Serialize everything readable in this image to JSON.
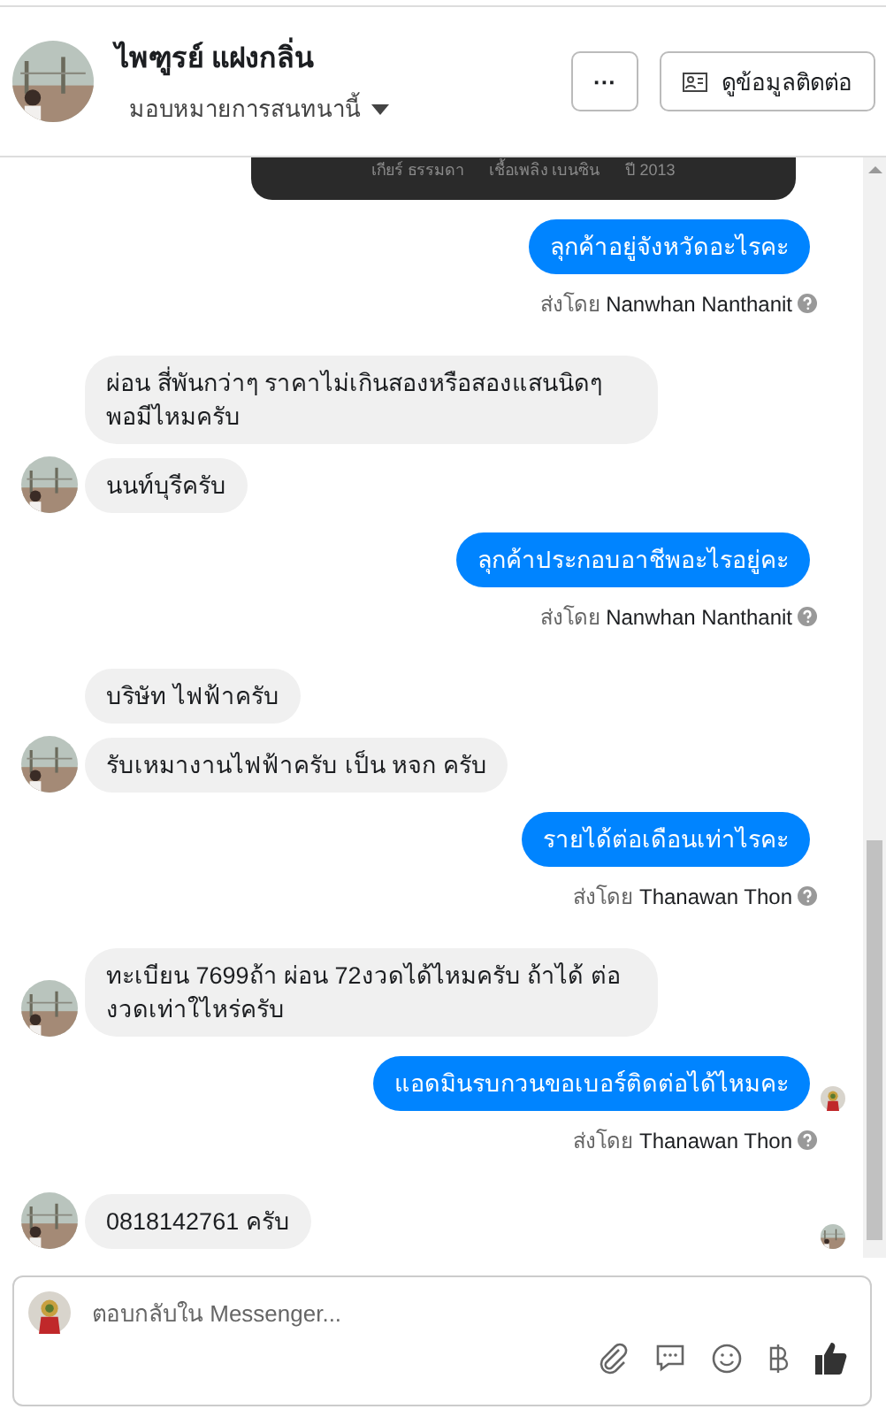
{
  "header": {
    "name": "ไพฑูรย์ แฝงกลิ่น",
    "assign": "มอบหมายการสนทนานี้",
    "more": "···",
    "contact": "ดูข้อมูลติดต่อ"
  },
  "card": {
    "specs": [
      "เกียร์ ธรรมดา",
      "เชื้อเพลิง เบนซิน",
      "ปี 2013"
    ]
  },
  "messages": [
    {
      "kind": "out",
      "text": "ลุกค้าอยู่จังหวัดอะไรคะ",
      "sent_by": "ส่งโดย",
      "agent": "Nanwhan Nanthanit"
    },
    {
      "kind": "in",
      "text": "ผ่อน สี่พันกว่าๆ ราคาไม่เกินสองหรือสองแสนนิดๆ พอมีไหมครับ",
      "avatar": false
    },
    {
      "kind": "in",
      "text": "นนท์บุรีครับ",
      "avatar": true
    },
    {
      "kind": "out",
      "text": "ลุกค้าประกอบอาชีพอะไรอยู่คะ",
      "sent_by": "ส่งโดย",
      "agent": "Nanwhan Nanthanit"
    },
    {
      "kind": "in",
      "text": "บริษัท ไฟฟ้าครับ",
      "avatar": false
    },
    {
      "kind": "in",
      "text": "รับเหมางานไฟฟ้าครับ เป็น หจก ครับ",
      "avatar": true
    },
    {
      "kind": "out",
      "text": "รายได้ต่อเดือนเท่าไรคะ",
      "sent_by": "ส่งโดย",
      "agent": "Thanawan Thon"
    },
    {
      "kind": "in",
      "text": "ทะเบียน 7699ถ้า ผ่อน 72งวดได้ไหมครับ ถ้าได้ ต่องวดเท่าใไหร่ครับ",
      "avatar": true
    },
    {
      "kind": "out",
      "text": "แอดมินรบกวนขอเบอร์ติดต่อได้ไหมคะ",
      "sent_by": "ส่งโดย",
      "agent": "Thanawan Thon",
      "seen": true
    },
    {
      "kind": "in",
      "text": "0818142761 ครับ",
      "avatar": true,
      "seen": true
    }
  ],
  "composer": {
    "placeholder": "ตอบกลับใน Messenger..."
  }
}
